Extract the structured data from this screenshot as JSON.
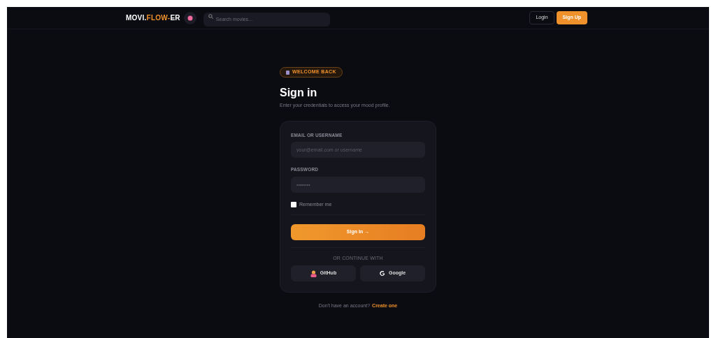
{
  "navbar": {
    "logo": [
      {
        "text": "MOVI.",
        "accent": false
      },
      {
        "text": "FLOW-",
        "accent": true
      },
      {
        "text": "ER",
        "accent": false
      }
    ],
    "search": {
      "placeholder": "Search movies..."
    },
    "buttons": [
      {
        "label": "Login",
        "kind": "outline"
      },
      {
        "label": "Sign Up",
        "kind": "primary"
      }
    ]
  },
  "badge": "WELCOME BACK",
  "title": "Sign in",
  "subtitle": "Enter your credentials to access your mood profile.",
  "form": {
    "fields": [
      {
        "label": "EMAIL OR USERNAME",
        "placeholder": "your@email.com or username"
      },
      {
        "label": "PASSWORD",
        "placeholder": "••••••••"
      }
    ],
    "remember": {
      "label": "Remember me",
      "checked": false
    },
    "submit": "Sign In →",
    "divider": "OR CONTINUE WITH",
    "providers": [
      {
        "label": "GitHub",
        "kind": "github"
      },
      {
        "label": "Google",
        "kind": "google"
      }
    ]
  },
  "footer": {
    "text": "Don't have an account?",
    "link": "Create one"
  }
}
